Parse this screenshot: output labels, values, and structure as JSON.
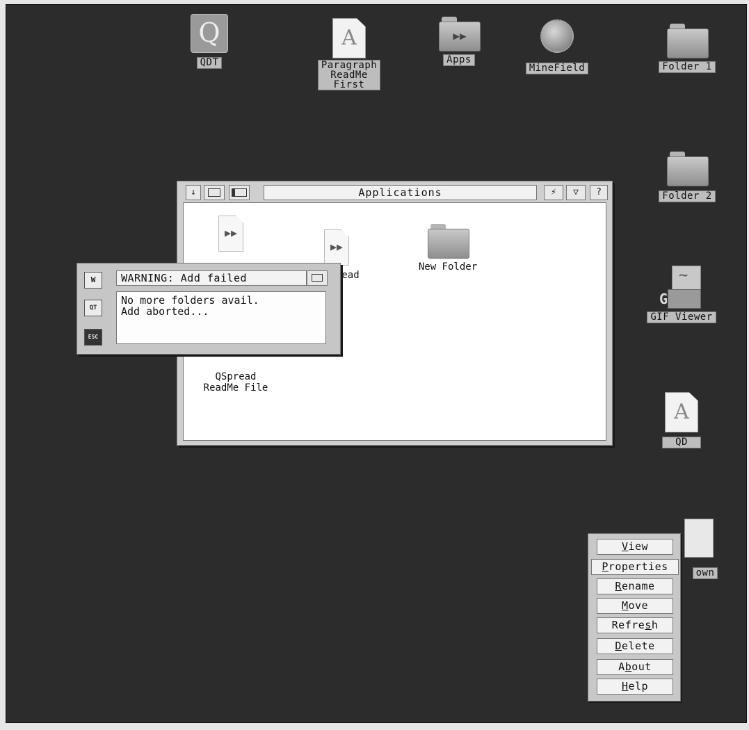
{
  "desktop": {
    "icons": [
      {
        "label": "QDT"
      },
      {
        "label_lines": [
          "Paragraph",
          "ReadMe",
          "First"
        ]
      },
      {
        "label": "Apps"
      },
      {
        "label": "MineField"
      },
      {
        "label": "Folder 1"
      },
      {
        "label": "Folder 2"
      },
      {
        "label": "GIF Viewer"
      },
      {
        "label": "QD"
      },
      {
        "label_partial": "own"
      }
    ]
  },
  "window": {
    "title": "Applications",
    "buttons": {
      "down_arrow": "↓",
      "help": "?"
    },
    "files": [
      {
        "label_partial": "ead"
      },
      {
        "label": "New Folder"
      },
      {
        "label_lines": [
          "QSpread",
          "ReadMe File"
        ]
      }
    ]
  },
  "dialog": {
    "title": "WARNING: Add failed",
    "lines": [
      "No more folders avail.",
      "Add aborted..."
    ],
    "side_icons": [
      "W",
      "QT",
      "ESC"
    ]
  },
  "context_menu": {
    "items": [
      {
        "before": "",
        "hot": "V",
        "after": "iew"
      },
      {
        "before": "",
        "hot": "P",
        "after": "roperties"
      },
      {
        "before": "",
        "hot": "R",
        "after": "ename"
      },
      {
        "before": "",
        "hot": "M",
        "after": "ove"
      },
      {
        "before": "Refre",
        "hot": "s",
        "after": "h"
      },
      {
        "before": "",
        "hot": "D",
        "after": "elete"
      },
      {
        "before": "A",
        "hot": "b",
        "after": "out"
      },
      {
        "before": "",
        "hot": "H",
        "after": "elp"
      }
    ]
  }
}
